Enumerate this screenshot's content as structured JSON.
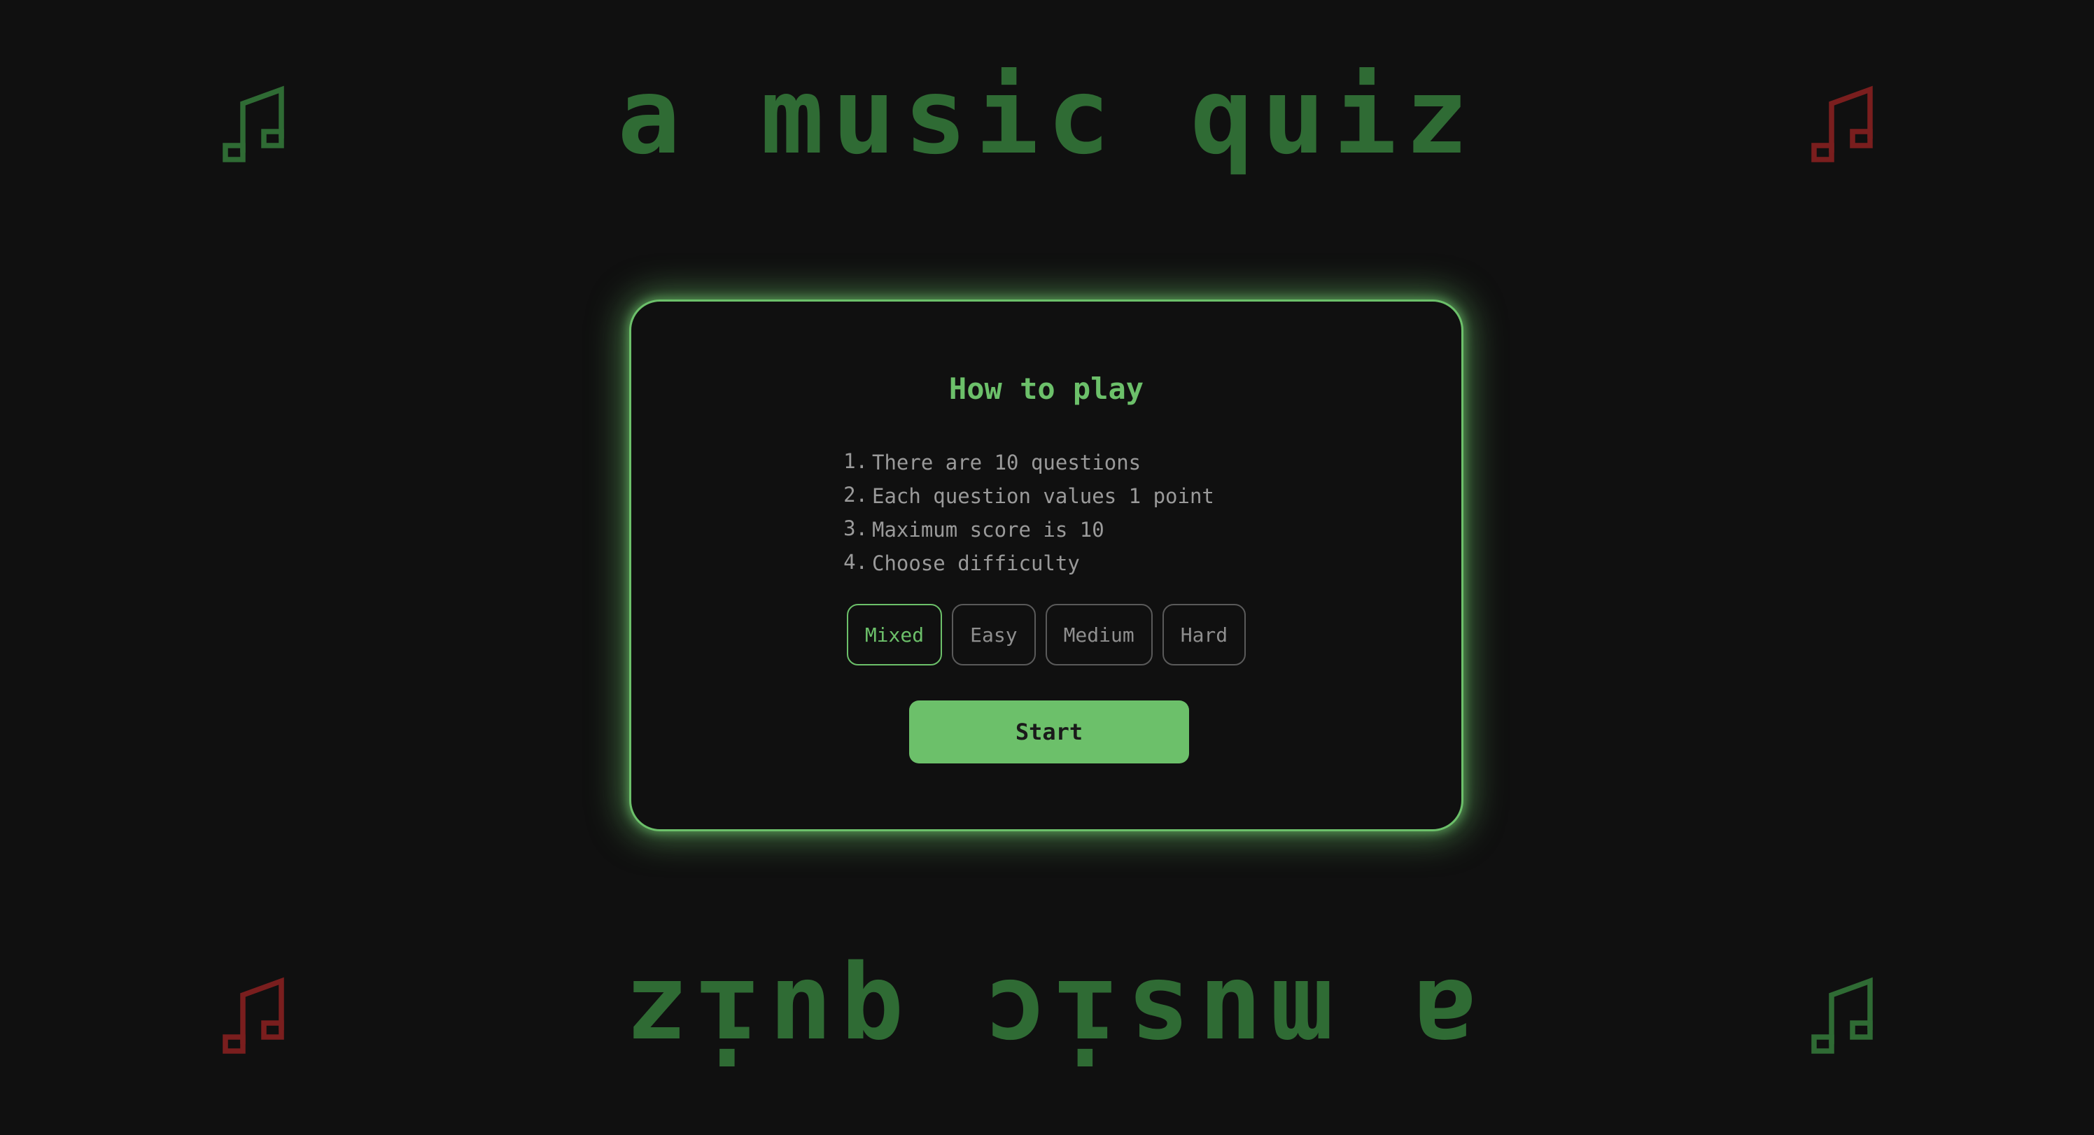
{
  "title": {
    "top": "a music quiz",
    "bottom": "a music quiz"
  },
  "icons": {
    "top_left": "music-note-icon",
    "top_right": "music-note-icon",
    "bottom_left": "music-note-icon",
    "bottom_right": "music-note-icon"
  },
  "colors": {
    "accent": "#6cc06a",
    "title": "#2f6b34",
    "note_green": "#2f6b34",
    "note_red": "#7a1e1e",
    "background": "#101010"
  },
  "card": {
    "heading": "How to play",
    "rules": [
      {
        "num": "1.",
        "text": "There are 10 questions"
      },
      {
        "num": "2.",
        "text": "Each question values 1 point"
      },
      {
        "num": "3.",
        "text": "Maximum score is 10"
      },
      {
        "num": "4.",
        "text": "Choose difficulty"
      }
    ],
    "difficulty": {
      "selected": "Mixed",
      "options": [
        "Mixed",
        "Easy",
        "Medium",
        "Hard"
      ]
    },
    "start_label": "Start"
  }
}
